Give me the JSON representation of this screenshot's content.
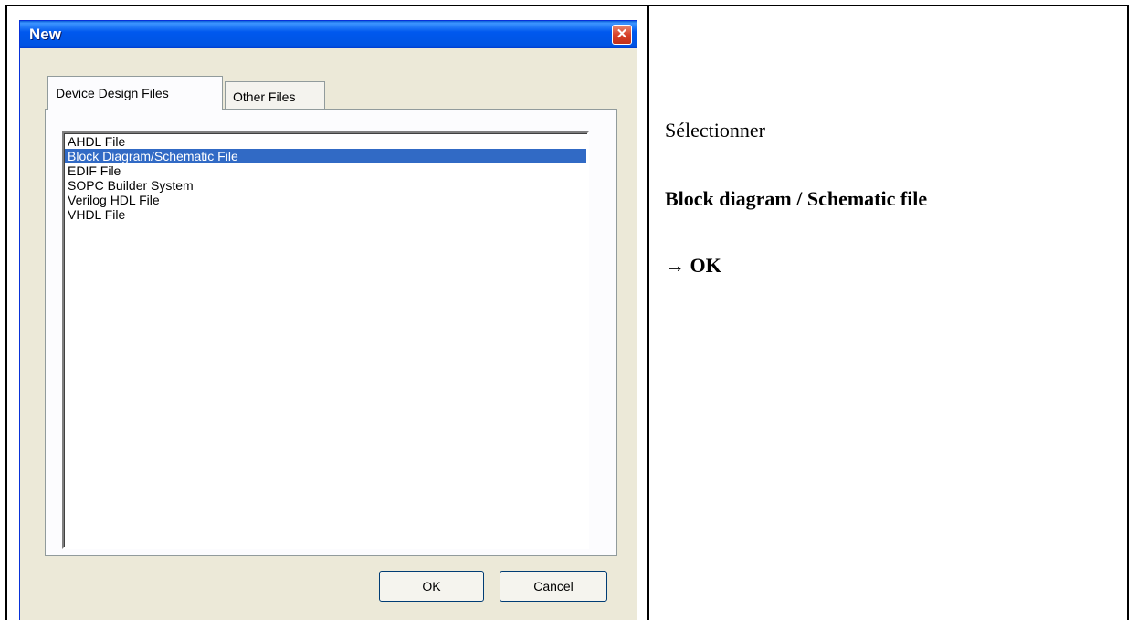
{
  "dialog": {
    "title": "New",
    "close_glyph": "✕",
    "tabs": [
      {
        "label": "Device Design Files",
        "active": true
      },
      {
        "label": "Other Files",
        "active": false
      }
    ],
    "file_types": [
      "AHDL File",
      "Block Diagram/Schematic File",
      "EDIF File",
      "SOPC Builder System",
      "Verilog HDL File",
      "VHDL File"
    ],
    "selected_index": 1,
    "buttons": {
      "ok": "OK",
      "cancel": "Cancel"
    }
  },
  "instructions": {
    "line1": "Sélectionner",
    "line2": "Block diagram / Schematic file",
    "line3": "→ OK"
  },
  "colors": {
    "titlebar": "#0054e3",
    "selection": "#316ac5",
    "dialog_bg": "#ece9d8",
    "close_button": "#d8422a"
  }
}
